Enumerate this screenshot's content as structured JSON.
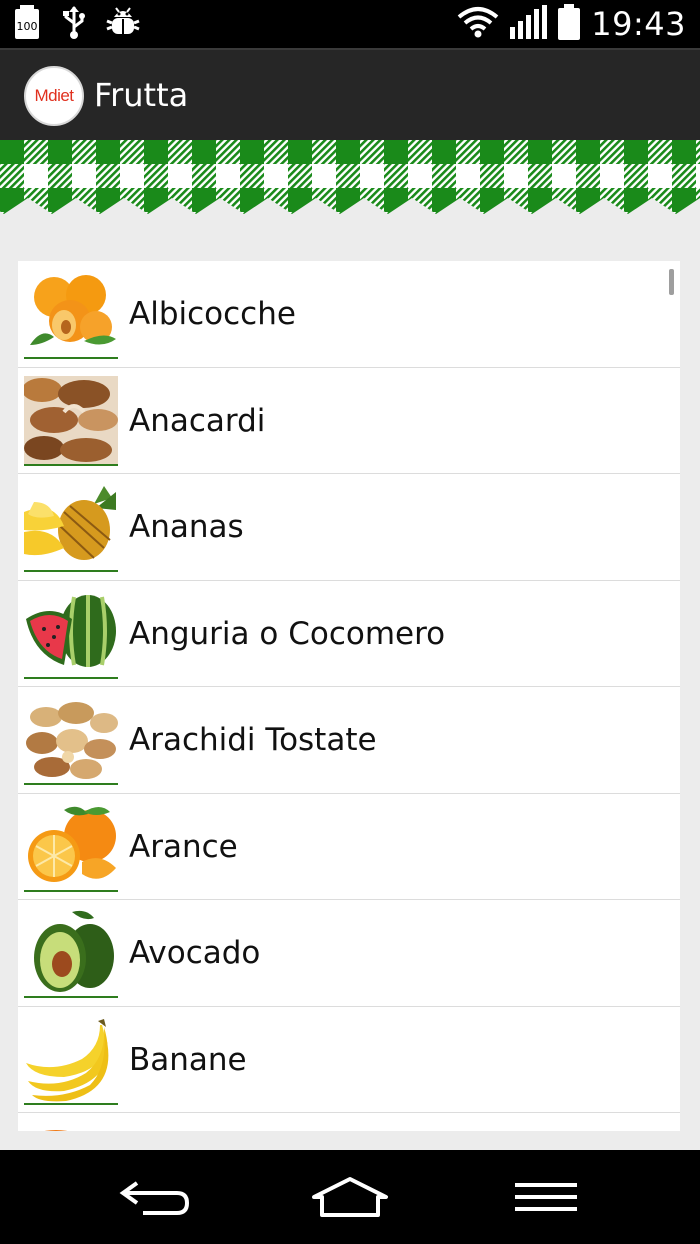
{
  "statusbar": {
    "time": "19:43",
    "battery_badge": "100",
    "icons": [
      "battery-100-icon",
      "usb-icon",
      "android-debug-icon",
      "wifi-icon",
      "signal-icon",
      "battery-icon"
    ]
  },
  "actionbar": {
    "logo_text": "Mdiet",
    "title": "Frutta"
  },
  "colors": {
    "gingham_green": "#1a8a1a",
    "accent_red": "#e0301e",
    "thumb_underline": "#2e7d1e"
  },
  "list": {
    "items": [
      {
        "label": "Albicocche",
        "icon": "apricot-icon"
      },
      {
        "label": "Anacardi",
        "icon": "cashew-icon"
      },
      {
        "label": "Ananas",
        "icon": "pineapple-icon"
      },
      {
        "label": "Anguria o Cocomero",
        "icon": "watermelon-icon"
      },
      {
        "label": "Arachidi Tostate",
        "icon": "peanut-icon"
      },
      {
        "label": "Arance",
        "icon": "orange-icon"
      },
      {
        "label": "Avocado",
        "icon": "avocado-icon"
      },
      {
        "label": "Banane",
        "icon": "banana-icon"
      }
    ]
  },
  "navbar": {
    "buttons": [
      "back-icon",
      "home-icon",
      "menu-icon"
    ]
  }
}
